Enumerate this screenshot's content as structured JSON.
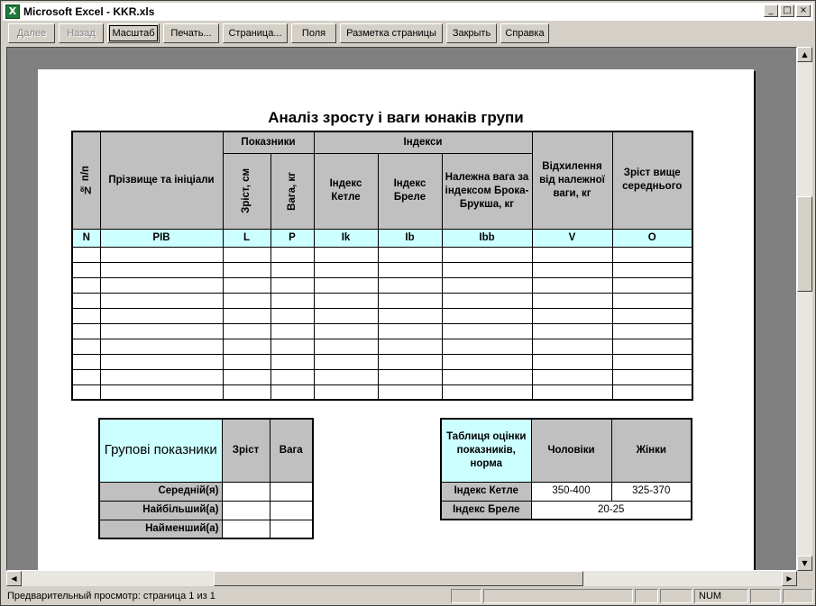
{
  "window": {
    "title": "Microsoft Excel - KKR.xls",
    "minimize": "_",
    "maximize": "□",
    "close": "×"
  },
  "toolbar": {
    "next": "Далее",
    "prev": "Назад",
    "zoom": "Масштаб",
    "print": "Печать...",
    "setup": "Страница...",
    "margins": "Поля",
    "page_break": "Разметка страницы",
    "close": "Закрыть",
    "help": "Справка"
  },
  "sheet": {
    "title": "Аналіз зросту і ваги юнаків групи",
    "headers": {
      "num": "№ п/п",
      "name": "Прізвище та ініціали",
      "indicators": "Показники",
      "indices": "Індекси",
      "height": "Зріст, см",
      "weight": "Вага, кг",
      "quetelet": "Індекс Кетле",
      "broca": "Індекс Бреле",
      "proper_weight": "Належна вага за індексом Брока-Брукша, кг",
      "deviation": "Відхилення від належної ваги, кг",
      "above_avg": "Зріст вище середнього"
    },
    "codes": [
      "N",
      "PIB",
      "L",
      "P",
      "Ik",
      "Ib",
      "Ibb",
      "V",
      "O"
    ],
    "group_table": {
      "title": "Групові показники",
      "col_height": "Зріст",
      "col_weight": "Вага",
      "rows": [
        "Середній(я)",
        "Найбільший(а)",
        "Найменший(а)"
      ]
    },
    "norm_table": {
      "title": "Таблиця оцінки показників, норма",
      "col_men": "Чоловіки",
      "col_women": "Жінки",
      "row1_label": "Індекс Кетле",
      "row1_men": "350-400",
      "row1_women": "325-370",
      "row2_label": "Індекс Бреле",
      "row2_value": "20-25"
    }
  },
  "status": {
    "text": "Предварительный просмотр: страница 1 из 1",
    "num": "NUM"
  }
}
